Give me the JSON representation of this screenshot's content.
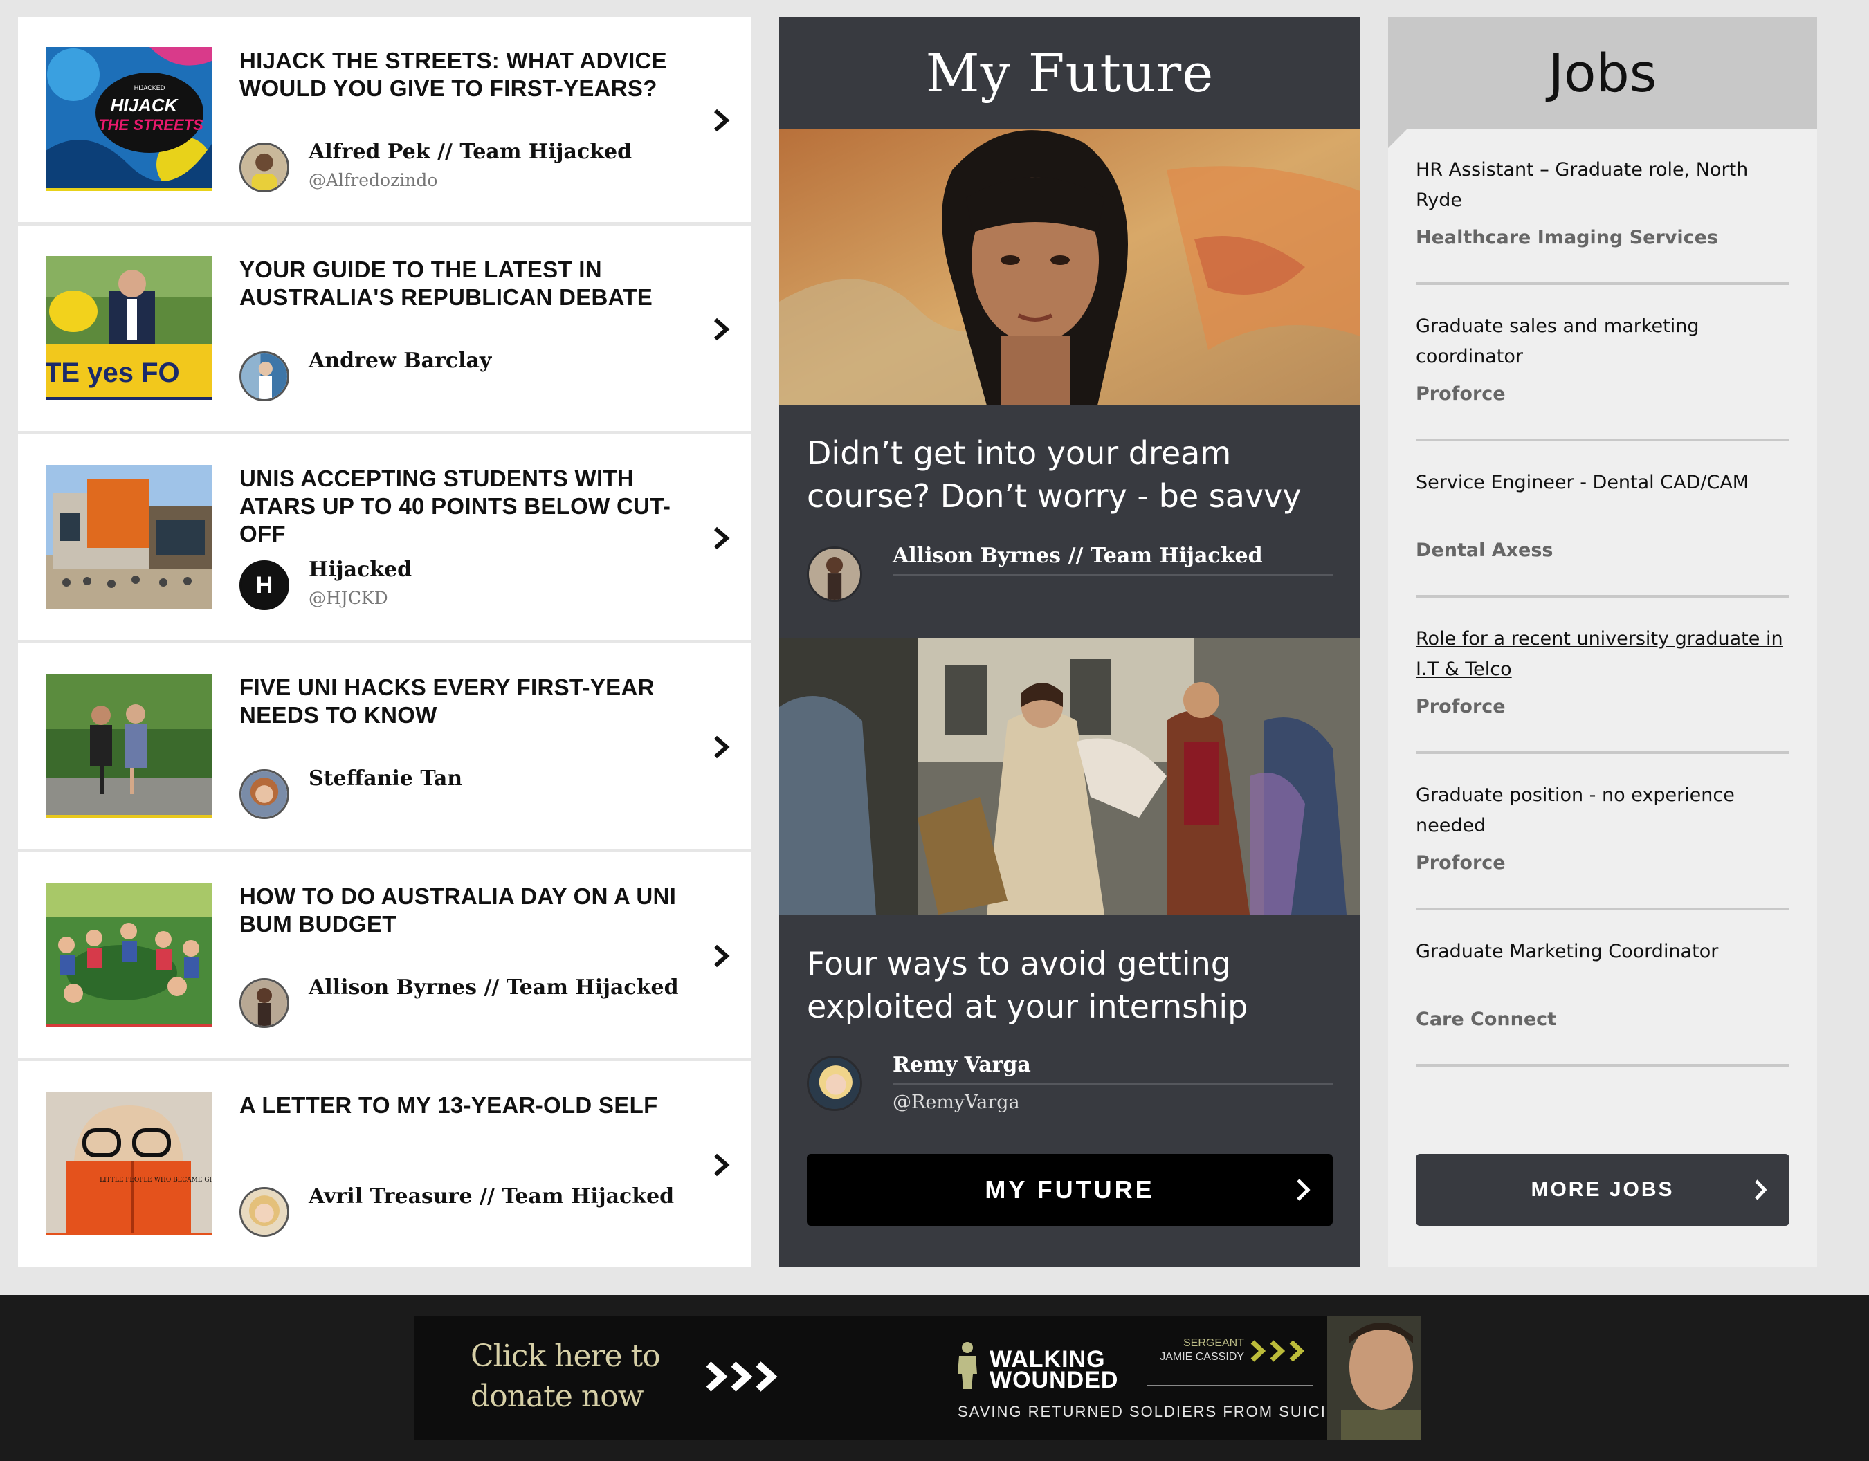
{
  "articles": [
    {
      "title": "HIJACK THE STREETS: WHAT ADVICE WOULD YOU GIVE TO FIRST-YEARS?",
      "author": "Alfred Pek // Team Hijacked",
      "handle": "@Alfredozindo",
      "thumb_text": {
        "small": "HIJACKED",
        "big1": "HIJACK",
        "big2": "THE STREETS"
      }
    },
    {
      "title": "YOUR GUIDE TO THE LATEST IN AUSTRALIA'S REPUBLICAN DEBATE",
      "author": "Andrew Barclay",
      "handle": "",
      "thumb_text": {
        "banner": "TE yes FO"
      }
    },
    {
      "title": "UNIS ACCEPTING STUDENTS WITH ATARS UP TO 40 POINTS BELOW CUT-OFF",
      "author": "Hijacked",
      "handle": "@HJCKD",
      "avatar_letter": "H"
    },
    {
      "title": "FIVE UNI HACKS EVERY FIRST-YEAR NEEDS TO KNOW",
      "author": "Steffanie Tan",
      "handle": ""
    },
    {
      "title": "HOW TO DO AUSTRALIA DAY ON A UNI BUM BUDGET",
      "author": "Allison Byrnes // Team Hijacked",
      "handle": ""
    },
    {
      "title": "A LETTER TO MY 13-YEAR-OLD SELF",
      "author": "Avril Treasure // Team Hijacked",
      "handle": "",
      "thumb_text": {
        "book": "LITTLE PEOPLE WHO BECAME GREAT"
      }
    }
  ],
  "future": {
    "heading": "My Future",
    "stories": [
      {
        "title": "Didn’t get into your dream course? Don’t worry - be savvy",
        "author": "Allison Byrnes // Team Hijacked",
        "handle": ""
      },
      {
        "title": "Four ways to avoid getting exploited at your internship",
        "author": "Remy Varga",
        "handle": "@RemyVarga"
      }
    ],
    "button_label": "MY FUTURE"
  },
  "jobs": {
    "heading": "Jobs",
    "listings": [
      {
        "title": "HR Assistant – Graduate role, North Ryde",
        "company": "Healthcare Imaging Services"
      },
      {
        "title": "Graduate sales and marketing coordinator",
        "company": "Proforce"
      },
      {
        "title": "Service Engineer - Dental CAD/CAM",
        "company": "Dental Axess"
      },
      {
        "title": "Role for a recent university graduate in I.T & Telco",
        "company": "Proforce"
      },
      {
        "title": "Graduate position - no experience needed",
        "company": "Proforce"
      },
      {
        "title": "Graduate Marketing Coordinator",
        "company": "Care Connect"
      }
    ],
    "button_label": "MORE JOBS"
  },
  "banner": {
    "donate_line1": "Click here to",
    "donate_line2": "donate now",
    "brand_line1": "WALKING",
    "brand_line2": "WOUNDED",
    "rank": "SERGEANT",
    "name": "JAMIE CASSIDY",
    "tagline": "SAVING RETURNED SOLDIERS FROM SUICIDE"
  },
  "colors": {
    "page_bg": "#e6e6e6",
    "future_bg": "#383a40",
    "jobs_bg": "#efefef",
    "jobs_header": "#c8c8c8",
    "banner_gold": "#d6cfa6"
  }
}
